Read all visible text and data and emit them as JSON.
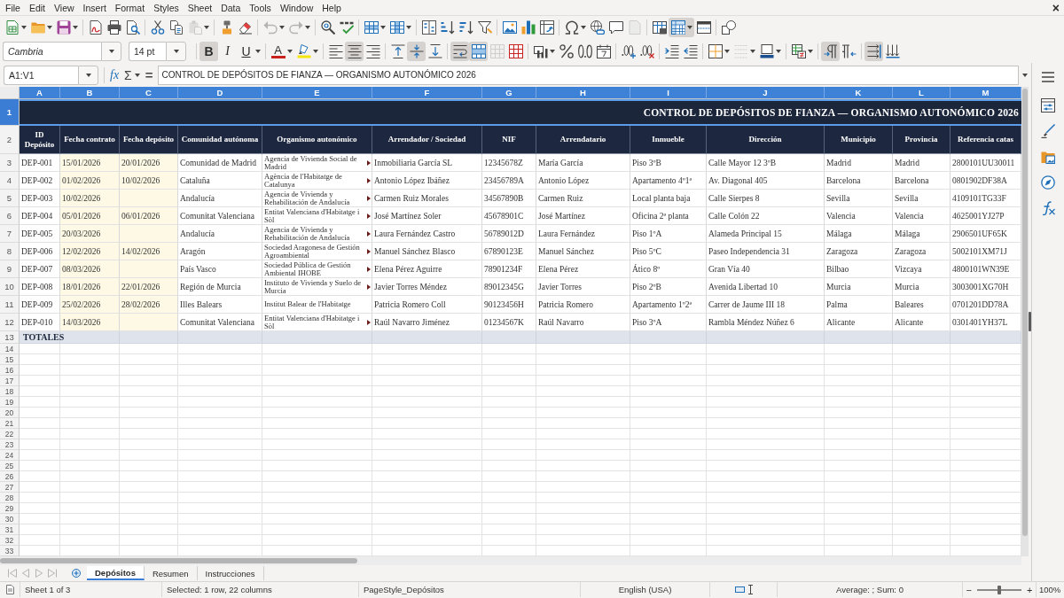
{
  "menu": [
    "File",
    "Edit",
    "View",
    "Insert",
    "Format",
    "Styles",
    "Sheet",
    "Data",
    "Tools",
    "Window",
    "Help"
  ],
  "close_document": "×",
  "toolbar_standard": [
    [
      {
        "kind": "new",
        "dropdown": true,
        "active": false,
        "disabled": false
      },
      {
        "kind": "open",
        "dropdown": true,
        "active": false,
        "disabled": false
      },
      {
        "kind": "save",
        "dropdown": true,
        "active": false,
        "disabled": false
      }
    ],
    [
      {
        "kind": "export_pdf",
        "dropdown": false,
        "active": false,
        "disabled": false
      },
      {
        "kind": "print",
        "dropdown": false,
        "active": false,
        "disabled": false
      },
      {
        "kind": "print_preview",
        "dropdown": false,
        "active": false,
        "disabled": false
      }
    ],
    [
      {
        "kind": "cut",
        "dropdown": false,
        "active": false,
        "disabled": false
      },
      {
        "kind": "copy",
        "dropdown": false,
        "active": false,
        "disabled": false
      },
      {
        "kind": "paste",
        "dropdown": true,
        "active": false,
        "disabled": true
      }
    ],
    [
      {
        "kind": "clone_formatting",
        "dropdown": false,
        "active": false,
        "disabled": false
      },
      {
        "kind": "clear_formatting",
        "dropdown": false,
        "active": false,
        "disabled": false
      }
    ],
    [
      {
        "kind": "undo",
        "dropdown": true,
        "active": false,
        "disabled": true
      },
      {
        "kind": "redo",
        "dropdown": true,
        "active": false,
        "disabled": true
      }
    ],
    [
      {
        "kind": "find_replace",
        "dropdown": false,
        "active": false,
        "disabled": false
      },
      {
        "kind": "spelling",
        "dropdown": false,
        "active": false,
        "disabled": false
      }
    ],
    [
      {
        "kind": "rows",
        "dropdown": true,
        "active": false,
        "disabled": false
      },
      {
        "kind": "columns",
        "dropdown": true,
        "active": false,
        "disabled": false
      }
    ],
    [
      {
        "kind": "sort",
        "dropdown": false,
        "active": false,
        "disabled": false
      },
      {
        "kind": "sort_ascending",
        "dropdown": false,
        "active": false,
        "disabled": false
      },
      {
        "kind": "sort_descending",
        "dropdown": false,
        "active": false,
        "disabled": false
      },
      {
        "kind": "autofilter",
        "dropdown": false,
        "active": false,
        "disabled": false
      }
    ],
    [
      {
        "kind": "image",
        "dropdown": false,
        "active": false,
        "disabled": false
      },
      {
        "kind": "chart",
        "dropdown": false,
        "active": false,
        "disabled": false
      },
      {
        "kind": "pivot_table",
        "dropdown": false,
        "active": false,
        "disabled": false
      }
    ],
    [
      {
        "kind": "special_character",
        "dropdown": true,
        "active": false,
        "disabled": false
      },
      {
        "kind": "hyperlink",
        "dropdown": false,
        "active": false,
        "disabled": false
      },
      {
        "kind": "comment",
        "dropdown": false,
        "active": false,
        "disabled": false
      },
      {
        "kind": "header_footer",
        "dropdown": false,
        "active": false,
        "disabled": true
      }
    ],
    [
      {
        "kind": "print_area",
        "dropdown": false,
        "active": false,
        "disabled": false
      },
      {
        "kind": "freeze",
        "dropdown": true,
        "active": true,
        "disabled": false
      },
      {
        "kind": "split_window",
        "dropdown": false,
        "active": false,
        "disabled": false
      }
    ],
    [
      {
        "kind": "draw_functions",
        "dropdown": false,
        "active": false,
        "disabled": false
      }
    ]
  ],
  "font_name": "Cambria",
  "font_size": "14 pt",
  "toolbar_formatting": [
    [
      {
        "kind": "bold",
        "label": "B",
        "dropdown": false,
        "active": true,
        "disabled": false
      },
      {
        "kind": "italic",
        "label": "I",
        "dropdown": false,
        "active": false,
        "disabled": false
      },
      {
        "kind": "underline",
        "label": "U",
        "dropdown": true,
        "active": false,
        "disabled": false
      }
    ],
    [
      {
        "kind": "font_color",
        "label": "A",
        "dropdown": true,
        "active": false,
        "disabled": false
      },
      {
        "kind": "highlight",
        "dropdown": true,
        "active": false,
        "disabled": false
      }
    ],
    [
      {
        "kind": "align_left",
        "dropdown": false,
        "active": false,
        "disabled": false
      },
      {
        "kind": "align_center",
        "dropdown": false,
        "active": true,
        "disabled": false
      },
      {
        "kind": "align_right",
        "dropdown": false,
        "active": false,
        "disabled": false
      }
    ],
    [
      {
        "kind": "align_top",
        "dropdown": false,
        "active": false,
        "disabled": false
      },
      {
        "kind": "center_vertical",
        "dropdown": false,
        "active": true,
        "disabled": false
      },
      {
        "kind": "align_bottom",
        "dropdown": false,
        "active": false,
        "disabled": false
      }
    ],
    [
      {
        "kind": "wrap_text",
        "dropdown": false,
        "active": true,
        "disabled": false
      },
      {
        "kind": "merge_center",
        "dropdown": false,
        "active": true,
        "disabled": false
      },
      {
        "kind": "merge_cells",
        "dropdown": false,
        "active": false,
        "disabled": true
      },
      {
        "kind": "unmerge",
        "dropdown": false,
        "active": false,
        "disabled": false
      }
    ],
    [
      {
        "kind": "currency",
        "dropdown": true,
        "active": false,
        "disabled": false
      },
      {
        "kind": "percent",
        "dropdown": false,
        "active": false,
        "disabled": false
      },
      {
        "kind": "number_format",
        "dropdown": false,
        "active": false,
        "disabled": false
      },
      {
        "kind": "date",
        "dropdown": false,
        "active": false,
        "disabled": false
      }
    ],
    [
      {
        "kind": "add_decimal",
        "dropdown": false,
        "active": false,
        "disabled": false
      },
      {
        "kind": "delete_decimal",
        "dropdown": false,
        "active": false,
        "disabled": false
      }
    ],
    [
      {
        "kind": "increase_indent",
        "dropdown": false,
        "active": false,
        "disabled": false
      },
      {
        "kind": "decrease_indent",
        "dropdown": false,
        "active": false,
        "disabled": false
      }
    ],
    [
      {
        "kind": "borders",
        "dropdown": true,
        "active": false,
        "disabled": false
      },
      {
        "kind": "border_style",
        "dropdown": true,
        "active": false,
        "disabled": true
      },
      {
        "kind": "border_color",
        "dropdown": true,
        "active": false,
        "disabled": false
      }
    ],
    [
      {
        "kind": "conditional",
        "dropdown": true,
        "active": false,
        "disabled": false
      }
    ],
    [
      {
        "kind": "ltr",
        "dropdown": false,
        "active": true,
        "disabled": false
      },
      {
        "kind": "rtl",
        "dropdown": false,
        "active": false,
        "disabled": false
      }
    ],
    [
      {
        "kind": "text_ltr",
        "dropdown": false,
        "active": true,
        "disabled": false
      },
      {
        "kind": "text_ttb",
        "dropdown": false,
        "active": false,
        "disabled": false
      }
    ]
  ],
  "formula_bar": {
    "name_box": "A1:V1",
    "function_wizard": "fx",
    "sum": "Σ",
    "equals": "=",
    "content": "CONTROL DE DEPÓSITOS DE FIANZA — ORGANISMO AUTONÓMICO 2026"
  },
  "sheet": {
    "columns": [
      {
        "letter": "A",
        "selected": true
      },
      {
        "letter": "B",
        "selected": true
      },
      {
        "letter": "C",
        "selected": true
      },
      {
        "letter": "D",
        "selected": true
      },
      {
        "letter": "E",
        "selected": true
      },
      {
        "letter": "F",
        "selected": true
      },
      {
        "letter": "G",
        "selected": true
      },
      {
        "letter": "H",
        "selected": true
      },
      {
        "letter": "I",
        "selected": true
      },
      {
        "letter": "J",
        "selected": true
      },
      {
        "letter": "K",
        "selected": true
      },
      {
        "letter": "L",
        "selected": true
      },
      {
        "letter": "M",
        "selected": true
      }
    ],
    "title_row": {
      "number": "1",
      "selected": true,
      "title": "CONTROL DE DEPÓSITOS DE FIANZA — ORGANISMO AUTONÓMICO 2026"
    },
    "header_row": {
      "number": "2",
      "selected": false,
      "headers": [
        "ID Depósito",
        "Fecha contrato",
        "Fecha depósito",
        "Comunidad autónoma",
        "Organismo autonómico",
        "Arrendador / Sociedad",
        "NIF",
        "Arrendatario",
        "Inmueble",
        "Dirección",
        "Municipio",
        "Provincia",
        "Referencia catas"
      ]
    },
    "rows": [
      {
        "number": "3",
        "selected": false,
        "overflow_marker": true,
        "id": "DEP-001",
        "fecha_contrato": "15/01/2026",
        "fecha_deposito": "20/01/2026",
        "comunidad": "Comunidad de Madrid",
        "organismo": "Agencia de Vivienda Social de Madrid",
        "arrendador": "Inmobiliaria García SL",
        "nif": "12345678Z",
        "arrendatario": "María García",
        "inmueble": "Piso 3ºB",
        "direccion": "Calle Mayor 12 3ºB",
        "municipio": "Madrid",
        "provincia": "Madrid",
        "referencia": "2800101UU30011"
      },
      {
        "number": "4",
        "selected": false,
        "overflow_marker": true,
        "id": "DEP-002",
        "fecha_contrato": "01/02/2026",
        "fecha_deposito": "10/02/2026",
        "comunidad": "Cataluña",
        "organismo": "Agència de l'Habitatge de Catalunya",
        "arrendador": "Antonio López Ibáñez",
        "nif": "23456789A",
        "arrendatario": "Antonio López",
        "inmueble": "Apartamento 4º1ª",
        "direccion": "Av. Diagonal 405",
        "municipio": "Barcelona",
        "provincia": "Barcelona",
        "referencia": "0801902DF38A"
      },
      {
        "number": "5",
        "selected": false,
        "overflow_marker": true,
        "id": "DEP-003",
        "fecha_contrato": "10/02/2026",
        "comunidad": "Andalucía",
        "organismo": "Agencia de Vivienda y Rehabilitación de Andalucía",
        "arrendador": "Carmen Ruiz Morales",
        "nif": "34567890B",
        "arrendatario": "Carmen Ruiz",
        "inmueble": "Local planta baja",
        "direccion": "Calle Sierpes 8",
        "municipio": "Sevilla",
        "provincia": "Sevilla",
        "referencia": "4109101TG33F"
      },
      {
        "number": "6",
        "selected": false,
        "overflow_marker": true,
        "id": "DEP-004",
        "fecha_contrato": "05/01/2026",
        "fecha_deposito": "06/01/2026",
        "comunidad": "Comunitat Valenciana",
        "organismo": "Entitat Valenciana d'Habitatge i Sòl",
        "arrendador": "José Martínez Soler",
        "nif": "45678901C",
        "arrendatario": "José Martínez",
        "inmueble": "Oficina 2ª planta",
        "direccion": "Calle Colón 22",
        "municipio": "Valencia",
        "provincia": "Valencia",
        "referencia": "4625001YJ27P"
      },
      {
        "number": "7",
        "selected": false,
        "overflow_marker": true,
        "id": "DEP-005",
        "fecha_contrato": "20/03/2026",
        "comunidad": "Andalucía",
        "organismo": "Agencia de Vivienda y Rehabilitación de Andalucía",
        "arrendador": "Laura Fernández Castro",
        "nif": "56789012D",
        "arrendatario": "Laura Fernández",
        "inmueble": "Piso 1ºA",
        "direccion": "Alameda Principal 15",
        "municipio": "Málaga",
        "provincia": "Málaga",
        "referencia": "2906501UF65K"
      },
      {
        "number": "8",
        "selected": false,
        "overflow_marker": true,
        "id": "DEP-006",
        "fecha_contrato": "12/02/2026",
        "fecha_deposito": "14/02/2026",
        "comunidad": "Aragón",
        "organismo": "Sociedad Aragonesa de Gestión Agroambiental",
        "arrendador": "Manuel Sánchez Blasco",
        "nif": "67890123E",
        "arrendatario": "Manuel Sánchez",
        "inmueble": "Piso 5ºC",
        "direccion": "Paseo Independencia 31",
        "municipio": "Zaragoza",
        "provincia": "Zaragoza",
        "referencia": "5002101XM71J"
      },
      {
        "number": "9",
        "selected": false,
        "overflow_marker": true,
        "id": "DEP-007",
        "fecha_contrato": "08/03/2026",
        "comunidad": "País Vasco",
        "organismo": "Sociedad Pública de Gestión Ambiental IHOBE",
        "arrendador": "Elena Pérez Aguirre",
        "nif": "78901234F",
        "arrendatario": "Elena Pérez",
        "inmueble": "Ático 8º",
        "direccion": "Gran Vía 40",
        "municipio": "Bilbao",
        "provincia": "Vizcaya",
        "referencia": "4800101WN39E"
      },
      {
        "number": "10",
        "selected": false,
        "overflow_marker": true,
        "id": "DEP-008",
        "fecha_contrato": "18/01/2026",
        "fecha_deposito": "22/01/2026",
        "comunidad": "Región de Murcia",
        "organismo": "Instituto de Vivienda y Suelo de Murcia",
        "arrendador": "Javier Torres Méndez",
        "nif": "89012345G",
        "arrendatario": "Javier Torres",
        "inmueble": "Piso 2ºB",
        "direccion": "Avenida Libertad 10",
        "municipio": "Murcia",
        "provincia": "Murcia",
        "referencia": "3003001XG70H"
      },
      {
        "number": "11",
        "selected": false,
        "overflow_marker": false,
        "id": "DEP-009",
        "fecha_contrato": "25/02/2026",
        "fecha_deposito": "28/02/2026",
        "comunidad": "Illes Balears",
        "organismo": "Institut Balear de l'Habitatge",
        "arrendador": "Patricia Romero Coll",
        "nif": "90123456H",
        "arrendatario": "Patricia Romero",
        "inmueble": "Apartamento 1º2ª",
        "direccion": "Carrer de Jaume III 18",
        "municipio": "Palma",
        "provincia": "Baleares",
        "referencia": "0701201DD78A"
      },
      {
        "number": "12",
        "selected": false,
        "overflow_marker": true,
        "id": "DEP-010",
        "fecha_contrato": "14/03/2026",
        "comunidad": "Comunitat Valenciana",
        "organismo": "Entitat Valenciana d'Habitatge i Sòl",
        "arrendador": "Raúl Navarro Jiménez",
        "nif": "01234567K",
        "arrendatario": "Raúl Navarro",
        "inmueble": "Piso 3ºA",
        "direccion": "Rambla Méndez Núñez 6",
        "municipio": "Alicante",
        "provincia": "Alicante",
        "referencia": "0301401YH37L"
      }
    ],
    "totals_row": {
      "number": "13",
      "selected": false,
      "label": "TOTALES"
    },
    "empty_rows": [
      {
        "number": "14",
        "selected": false
      },
      {
        "number": "15",
        "selected": false
      },
      {
        "number": "16",
        "selected": false
      },
      {
        "number": "17",
        "selected": false
      },
      {
        "number": "18",
        "selected": false
      },
      {
        "number": "19",
        "selected": false
      },
      {
        "number": "20",
        "selected": false
      },
      {
        "number": "21",
        "selected": false
      },
      {
        "number": "22",
        "selected": false
      },
      {
        "number": "23",
        "selected": false
      },
      {
        "number": "24",
        "selected": false
      },
      {
        "number": "25",
        "selected": false
      },
      {
        "number": "26",
        "selected": false
      },
      {
        "number": "27",
        "selected": false
      },
      {
        "number": "28",
        "selected": false
      },
      {
        "number": "29",
        "selected": false
      },
      {
        "number": "30",
        "selected": false
      },
      {
        "number": "31",
        "selected": false
      },
      {
        "number": "32",
        "selected": false
      },
      {
        "number": "33",
        "selected": false
      }
    ]
  },
  "sheet_navigation": [
    {
      "kind": "first",
      "disabled": true
    },
    {
      "kind": "previous",
      "disabled": true
    },
    {
      "kind": "next",
      "disabled": true
    },
    {
      "kind": "last",
      "disabled": true
    }
  ],
  "sheet_tabs": [
    {
      "label": "Depósitos",
      "selected": true
    },
    {
      "label": "Resumen",
      "selected": false
    },
    {
      "label": "Instrucciones",
      "selected": false
    }
  ],
  "status_bar": {
    "sheet": "Sheet 1 of 3",
    "selection": "Selected: 1 row, 22 columns",
    "page_style": "PageStyle_Depósitos",
    "language": "English (USA)",
    "statistics": "Average: ; Sum: 0",
    "zoom_out": "−",
    "zoom_slider": {
      "level": 0.5
    },
    "zoom_in": "+",
    "zoom": "100%"
  }
}
